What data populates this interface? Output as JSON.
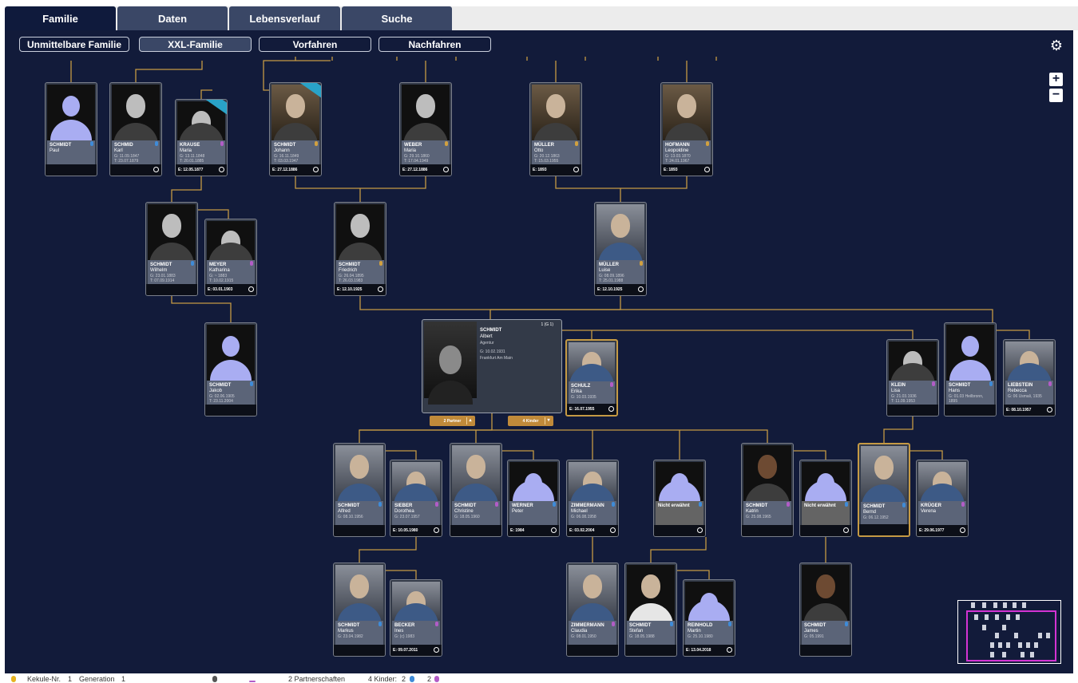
{
  "tabs": [
    "Familie",
    "Daten",
    "Lebensverlauf",
    "Suche"
  ],
  "views": [
    "Unmittelbare Familie",
    "XXL-Familie",
    "Vorfahren",
    "Nachfahren"
  ],
  "icons": {
    "settings": "gear-icon",
    "zoom_in": "plus-icon",
    "zoom_out": "minus-icon"
  },
  "persons": {
    "paul": {
      "surname": "SCHMIDT",
      "given": "Paul",
      "d1": "",
      "d2": "",
      "marriage": ""
    },
    "karl": {
      "surname": "SCHMID",
      "given": "Karl",
      "d1": "G: 11.09.1847",
      "d2": "T: 23.07.1879",
      "marriage": ""
    },
    "maria_k": {
      "surname": "KRAUSE",
      "given": "Maria",
      "d1": "G: 13.11.1848",
      "d2": "T: 20.01.1885",
      "marriage": "E: 12.05.1877"
    },
    "johann": {
      "surname": "SCHMIDT",
      "given": "Johann",
      "d1": "G: 16.11.1849",
      "d2": "T: 03.03.1947",
      "marriage": "E: 27.12.1886"
    },
    "maria_w": {
      "surname": "WEBER",
      "given": "Maria",
      "d1": "G: 29.10.1860",
      "d2": "T: 17.04.1949",
      "marriage": "E: 27.12.1886"
    },
    "otto": {
      "surname": "MÜLLER",
      "given": "Otto",
      "d1": "G: 20.12.1863",
      "d2": "T: 15.03.1955",
      "marriage": "E: 1893"
    },
    "leopoldine": {
      "surname": "HOFMANN",
      "given": "Leopoldine",
      "d1": "G: 13.03.1870",
      "d2": "T: 24.01.1967",
      "marriage": "E: 1893"
    },
    "wilhelm": {
      "surname": "SCHMIDT",
      "given": "Wilhelm",
      "d1": "G: 23.01.1883",
      "d2": "T: 07.09.1914",
      "marriage": ""
    },
    "katharina": {
      "surname": "MEYER",
      "given": "Katharina",
      "d1": "G: ~ 1883",
      "d2": "T: 10.02.1915",
      "marriage": "E: 03.01.1903"
    },
    "friedrich": {
      "surname": "SCHMIDT",
      "given": "Friedrich",
      "d1": "G: 26.04.1895",
      "d2": "T: 26.03.1983",
      "marriage": "E: 12.10.1925"
    },
    "luise": {
      "surname": "MÜLLER",
      "given": "Luise",
      "d1": "G: 08.09.1896",
      "d2": "T: 25.01.1988",
      "marriage": "E: 12.10.1925"
    },
    "jakob": {
      "surname": "SCHMIDT",
      "given": "Jakob",
      "d1": "G: 02.06.1905",
      "d2": "T: 23.11.2004",
      "marriage": ""
    },
    "erika": {
      "surname": "SCHULZ",
      "given": "Erika",
      "d1": "G: 10.03.1935",
      "d2": "",
      "marriage": "E: 16.07.1955"
    },
    "lisa": {
      "surname": "KLEIN",
      "given": "Lisa",
      "d1": "G: 21.03.1936",
      "d2": "T: 11.09.1953",
      "marriage": ""
    },
    "hans": {
      "surname": "SCHMIDT",
      "given": "Hans",
      "d1": "G: 01.03 Heilbronn, 1895",
      "d2": "",
      "marriage": ""
    },
    "rebecca": {
      "surname": "LIEBSTEIN",
      "given": "Rebecca",
      "d1": "G: 06 Usmali, 1935",
      "d2": "",
      "marriage": "E: 08.10.1957"
    },
    "alfred": {
      "surname": "SCHMIDT",
      "given": "Alfred",
      "d1": "G: 08.10.1956",
      "d2": "",
      "marriage": ""
    },
    "dorothea": {
      "surname": "SIEBER",
      "given": "Dorothea",
      "d1": "G: 23.07.1957",
      "d2": "",
      "marriage": "E: 10.05.1980"
    },
    "christine": {
      "surname": "SCHMIDT",
      "given": "Christine",
      "d1": "G: 18.05.1960",
      "d2": "",
      "marriage": ""
    },
    "peter": {
      "surname": "WERNER",
      "given": "Peter",
      "d1": "",
      "d2": "",
      "marriage": "E: 1984"
    },
    "michael": {
      "surname": "ZIMMERMANN",
      "given": "Michael",
      "d1": "G: 06.08.1958",
      "d2": "",
      "marriage": "E: 03.02.2004"
    },
    "ne1": {
      "surname": "Nicht erwähnt",
      "given": "",
      "d1": "",
      "d2": "",
      "marriage": ""
    },
    "katrin": {
      "surname": "SCHMIDT",
      "given": "Katrin",
      "d1": "G: 25.08.1965",
      "d2": "",
      "marriage": ""
    },
    "ne2": {
      "surname": "Nicht erwähnt",
      "given": "",
      "d1": "",
      "d2": "",
      "marriage": ""
    },
    "bernd": {
      "surname": "SCHMIDT",
      "given": "Bernd",
      "d1": "G: 06.12.1952",
      "d2": "",
      "marriage": ""
    },
    "verena": {
      "surname": "KRÜGER",
      "given": "Verena",
      "d1": "",
      "d2": "",
      "marriage": "E: 29.06.1977"
    },
    "markus": {
      "surname": "SCHMIDT",
      "given": "Markus",
      "d1": "G: 23.04.1982",
      "d2": "",
      "marriage": ""
    },
    "ines": {
      "surname": "BECKER",
      "given": "Ines",
      "d1": "G: (c) 1983",
      "d2": "",
      "marriage": "E: 09.07.2011"
    },
    "claudia": {
      "surname": "ZIMMERMANN",
      "given": "Claudia",
      "d1": "G: 08.01.1950",
      "d2": "",
      "marriage": ""
    },
    "stefan": {
      "surname": "SCHMIDT",
      "given": "Stefan",
      "d1": "G: 18.05.1988",
      "d2": "",
      "marriage": ""
    },
    "martin": {
      "surname": "REINHOLD",
      "given": "Martin",
      "d1": "G: 25.10.1980",
      "d2": "",
      "marriage": "E: 13.04.2018"
    },
    "james": {
      "surname": "SCHMIDT",
      "given": "James",
      "d1": "G: 05.1991",
      "d2": "",
      "marriage": ""
    }
  },
  "focus": {
    "surname": "SCHMIDT",
    "given": "Albert",
    "occupation": "Agentur",
    "birth": "G: 10.02.1931",
    "place": "Frankfurt Am Main",
    "generation": "1 (G 1)",
    "partners_btn": "2 Partner",
    "children_btn": "4 Kinder"
  },
  "status": {
    "kekule_label": "Kekule-Nr.",
    "kekule_value": "1",
    "generation_label": "Generation",
    "generation_value": "1",
    "partnerships": "2 Partnerschaften",
    "children_label": "4 Kinder:",
    "sons": "2",
    "daughters": "2"
  },
  "colors": {
    "canvas": "#121b3a",
    "line": "#c59a44",
    "male": "#3f8bd8",
    "female": "#b25cc7",
    "minimap_view": "#d333d3"
  }
}
